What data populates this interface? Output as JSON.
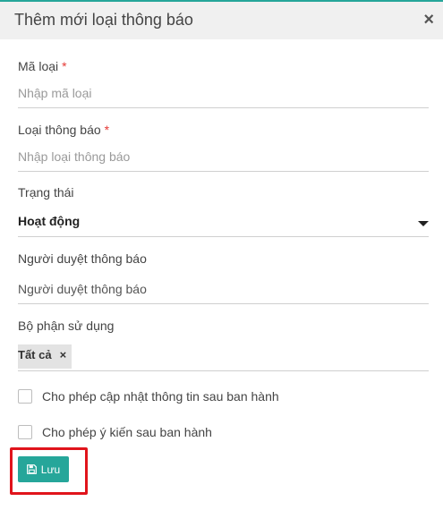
{
  "modal": {
    "title": "Thêm mới loại thông báo",
    "close_label": "×"
  },
  "fields": {
    "ma_loai": {
      "label": "Mã loại",
      "required_mark": "*",
      "placeholder": "Nhập mã loại"
    },
    "loai_thong_bao": {
      "label": "Loại thông báo",
      "required_mark": "*",
      "placeholder": "Nhập loại thông báo"
    },
    "trang_thai": {
      "label": "Trạng thái",
      "value": "Hoạt động"
    },
    "nguoi_duyet": {
      "label": "Người duyệt thông báo",
      "placeholder": "Người duyệt thông báo"
    },
    "bo_phan": {
      "label": "Bộ phận sử dụng",
      "tags": [
        "Tất cả"
      ],
      "tag_remove": "×"
    }
  },
  "checkboxes": [
    {
      "label": "Cho phép cập nhật thông tin sau ban hành",
      "checked": false
    },
    {
      "label": "Cho phép ý kiến sau ban hành",
      "checked": false
    }
  ],
  "actions": {
    "save_label": "Lưu",
    "save_icon": "floppy-disk-icon"
  },
  "colors": {
    "accent": "#26a69a",
    "required": "#e53935",
    "highlight": "#e0141b"
  }
}
